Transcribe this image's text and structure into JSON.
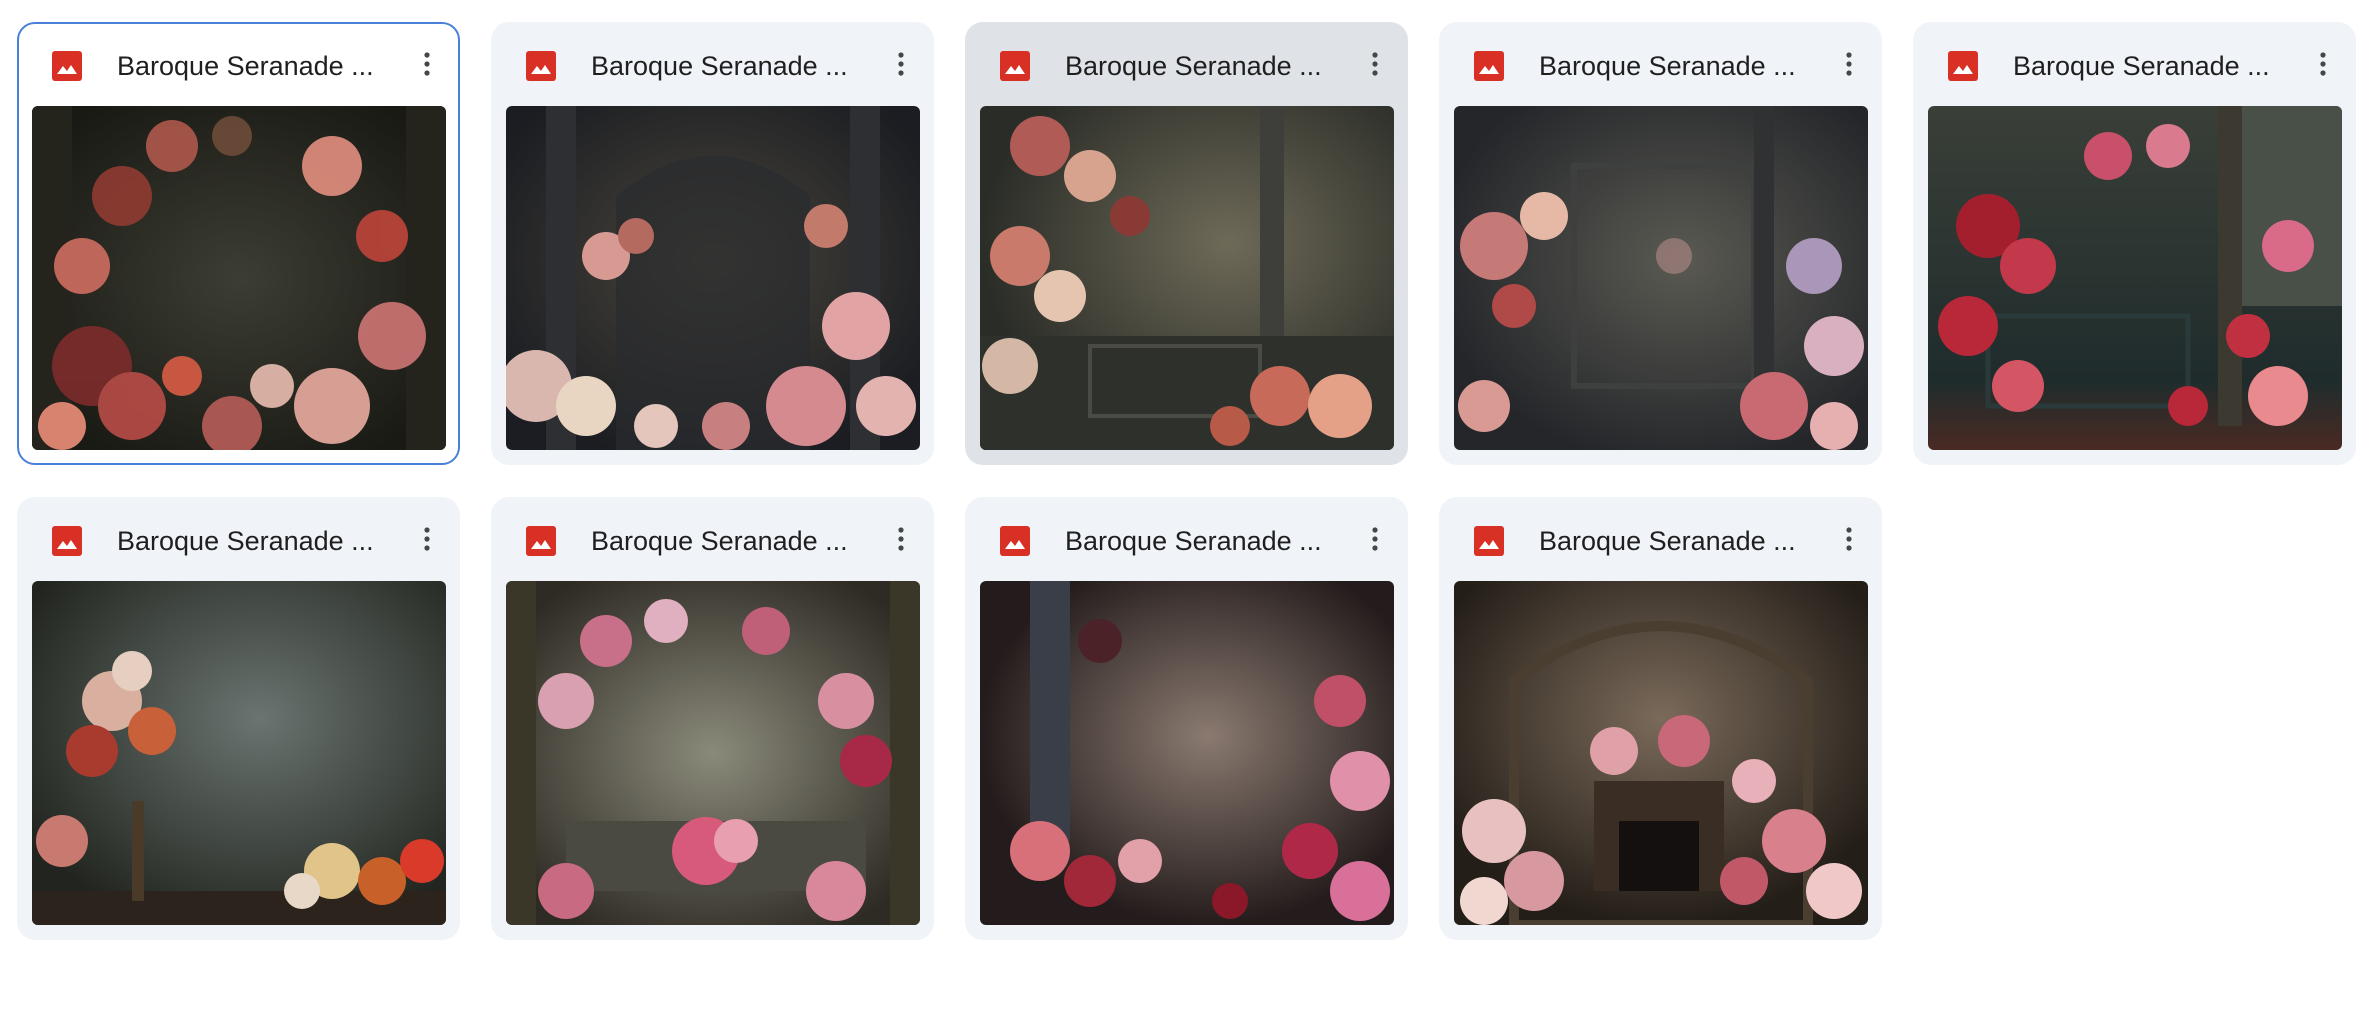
{
  "files": [
    {
      "title": "Baroque Seranade ...",
      "icon": "image-file-icon",
      "menu_icon": "more-vert-icon",
      "state": "selected"
    },
    {
      "title": "Baroque Seranade ...",
      "icon": "image-file-icon",
      "menu_icon": "more-vert-icon",
      "state": "normal"
    },
    {
      "title": "Baroque Seranade ...",
      "icon": "image-file-icon",
      "menu_icon": "more-vert-icon",
      "state": "hover"
    },
    {
      "title": "Baroque Seranade ...",
      "icon": "image-file-icon",
      "menu_icon": "more-vert-icon",
      "state": "normal"
    },
    {
      "title": "Baroque Seranade ...",
      "icon": "image-file-icon",
      "menu_icon": "more-vert-icon",
      "state": "normal"
    },
    {
      "title": "Baroque Seranade ...",
      "icon": "image-file-icon",
      "menu_icon": "more-vert-icon",
      "state": "normal"
    },
    {
      "title": "Baroque Seranade ...",
      "icon": "image-file-icon",
      "menu_icon": "more-vert-icon",
      "state": "normal"
    },
    {
      "title": "Baroque Seranade ...",
      "icon": "image-file-icon",
      "menu_icon": "more-vert-icon",
      "state": "normal"
    },
    {
      "title": "Baroque Seranade ...",
      "icon": "image-file-icon",
      "menu_icon": "more-vert-icon",
      "state": "normal"
    }
  ],
  "colors": {
    "card_bg": "#f0f4f9",
    "card_hover_bg": "#dfe2e7",
    "selected_border": "#4a80d8",
    "image_icon": "#d93025",
    "title_text": "#1f1f1f",
    "menu_icon": "#444746"
  }
}
